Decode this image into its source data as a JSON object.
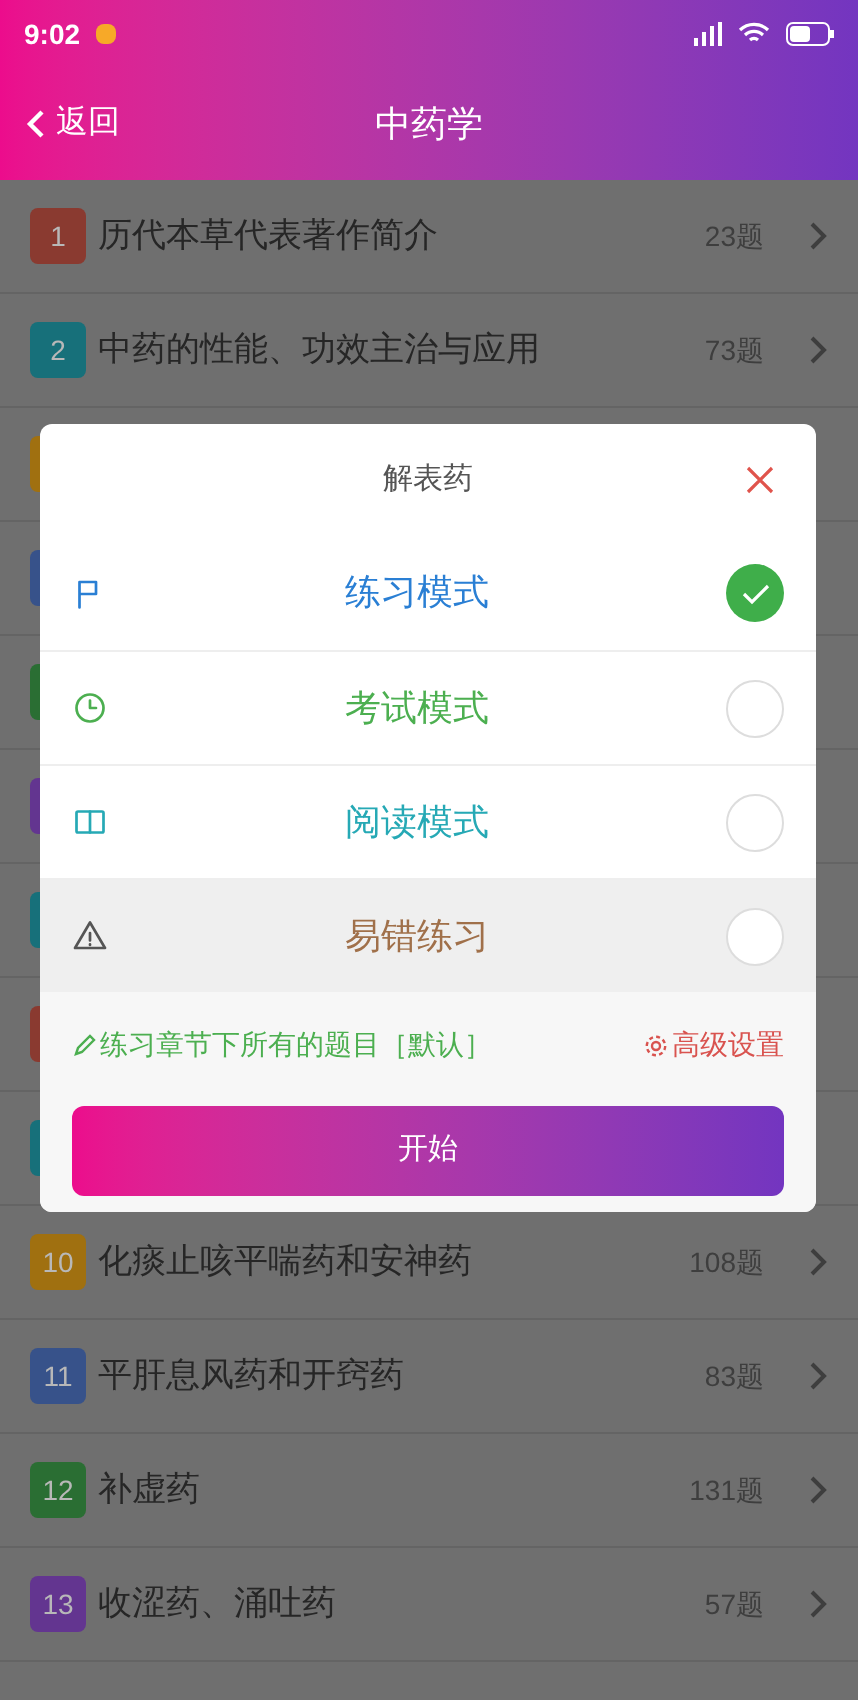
{
  "status_bar": {
    "time": "9:02"
  },
  "header": {
    "back": "返回",
    "title": "中药学"
  },
  "chapters": [
    {
      "number": "1",
      "title": "历代本草代表著作简介",
      "count": "23题",
      "color": "#8a3a30"
    },
    {
      "number": "2",
      "title": "中药的性能、功效主治与应用",
      "count": "73题",
      "color": "#17707a"
    },
    {
      "color": "#a07010"
    },
    {
      "color": "#37528a"
    },
    {
      "color": "#2a6e33"
    },
    {
      "color": "#633590"
    },
    {
      "color": "#17707a"
    },
    {
      "color": "#8a3a30"
    },
    {
      "color": "#17707a"
    },
    {
      "number": "10",
      "title": "化痰止咳平喘药和安神药",
      "count": "108题",
      "color": "#a07010"
    },
    {
      "number": "11",
      "title": "平肝息风药和开窍药",
      "count": "83题",
      "color": "#37528a"
    },
    {
      "number": "12",
      "title": "补虚药",
      "count": "131题",
      "color": "#2a6e33"
    },
    {
      "number": "13",
      "title": "收涩药、涌吐药",
      "count": "57题",
      "color": "#633590"
    }
  ],
  "dialog": {
    "title": "解表药",
    "modes": [
      {
        "kind": "flag",
        "label": "练习模式",
        "color": "#2a7fd4",
        "selected": true,
        "highlighted": false
      },
      {
        "kind": "clock",
        "label": "考试模式",
        "color": "#4caf50",
        "selected": false,
        "highlighted": false
      },
      {
        "kind": "book",
        "label": "阅读模式",
        "color": "#26a9b5",
        "selected": false,
        "highlighted": false
      },
      {
        "kind": "warning",
        "label": "易错练习",
        "color": "#a0704a",
        "selected": false,
        "highlighted": true
      }
    ],
    "scope": "练习章节下所有的题目［默认］",
    "advanced": "高级设置",
    "start": "开始"
  }
}
